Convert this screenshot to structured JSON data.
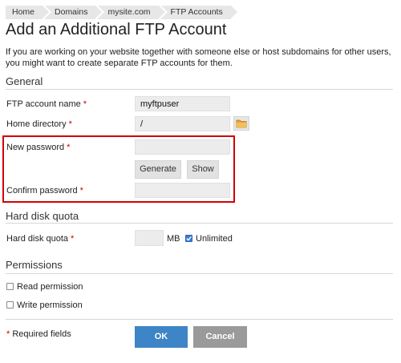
{
  "breadcrumb": [
    "Home",
    "Domains",
    "mysite.com",
    "FTP Accounts"
  ],
  "page_title": "Add an Additional FTP Account",
  "intro": "If you are working on your website together with someone else or host subdomains for other users, you might want to create separate FTP accounts for them.",
  "sections": {
    "general": "General",
    "quota": "Hard disk quota",
    "permissions": "Permissions"
  },
  "form": {
    "account_name_label": "FTP account name",
    "account_name_value": "myftpuser",
    "home_dir_label": "Home directory",
    "home_dir_value": "/",
    "new_password_label": "New password",
    "new_password_value": "",
    "generate_label": "Generate",
    "show_label": "Show",
    "confirm_password_label": "Confirm password",
    "confirm_password_value": "",
    "quota_label": "Hard disk quota",
    "quota_value": "",
    "quota_unit": "MB",
    "unlimited_label": "Unlimited",
    "unlimited_checked": true,
    "read_permission_label": "Read permission",
    "read_permission_checked": false,
    "write_permission_label": "Write permission",
    "write_permission_checked": false,
    "required_marker": "*",
    "required_note": "Required fields"
  },
  "buttons": {
    "ok": "OK",
    "cancel": "Cancel"
  },
  "colors": {
    "highlight_border": "#d10000",
    "ok_button": "#3d85c6",
    "cancel_button": "#9a9a9a",
    "required": "#cc0000"
  },
  "icons": {
    "folder": "folder-icon",
    "checkmark": "checkmark-icon"
  }
}
